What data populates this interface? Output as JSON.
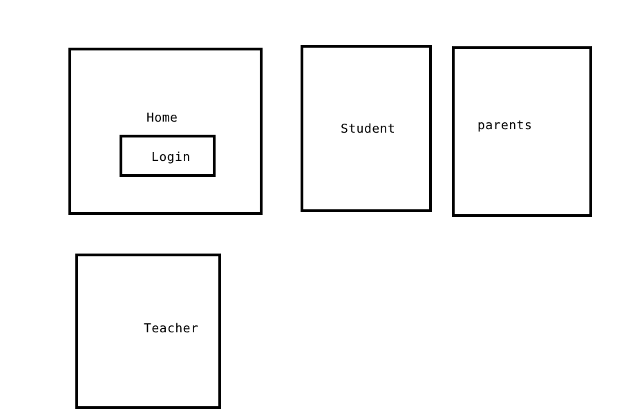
{
  "home": {
    "title": "Home",
    "login_label": "Login"
  },
  "student": {
    "title": "Student"
  },
  "parents": {
    "title": "parents"
  },
  "teacher": {
    "title": "Teacher"
  }
}
